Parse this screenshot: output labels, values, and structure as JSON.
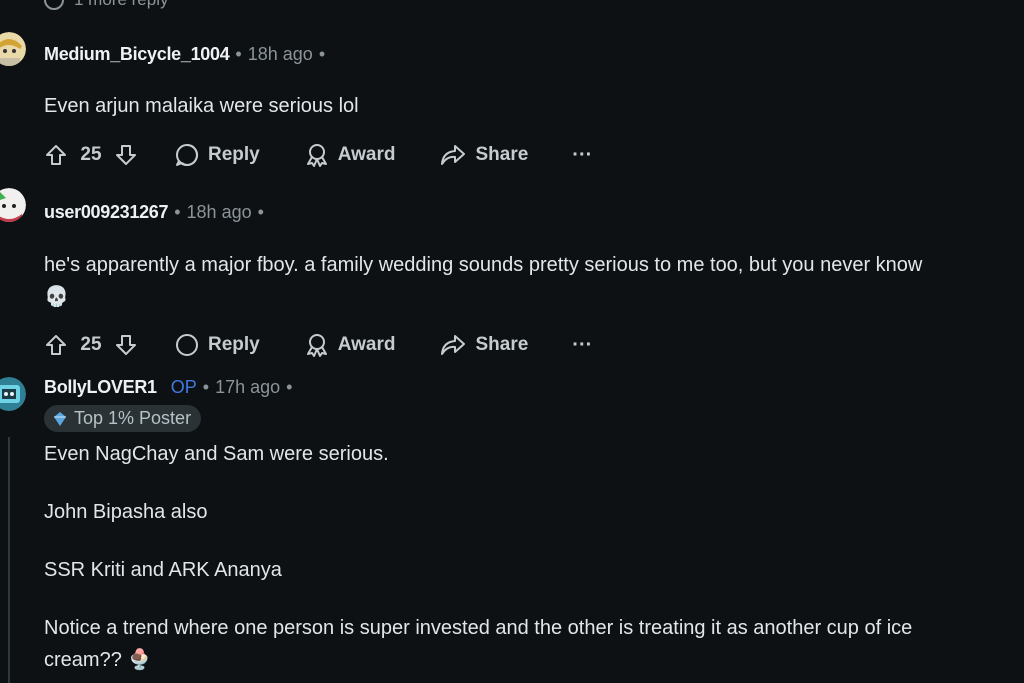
{
  "more_reply": {
    "label": "1 more reply"
  },
  "comments": [
    {
      "username": "Medium_Bicycle_1004",
      "op": "",
      "time": "18h ago",
      "flair": "",
      "body": [
        "Even arjun malaika were serious lol"
      ],
      "votes": "25",
      "actions": {
        "reply": "Reply",
        "award": "Award",
        "share": "Share",
        "more": "···"
      }
    },
    {
      "username": "user009231267",
      "op": "",
      "time": "18h ago",
      "flair": "",
      "body": [
        "he's apparently a major fboy. a family wedding sounds pretty serious to me too, but you never know",
        "💀"
      ],
      "votes": "25",
      "actions": {
        "reply": "Reply",
        "award": "Award",
        "share": "Share",
        "more": "···"
      }
    },
    {
      "username": "BollyLOVER1",
      "op": "OP",
      "time": "17h ago",
      "flair": "Top 1% Poster",
      "body": [
        "Even NagChay and Sam were serious.",
        "John Bipasha also",
        "SSR Kriti and ARK Ananya",
        "Notice a trend where one person is super invested and the other is treating it as another cup of ice",
        "cream?? 🍨"
      ]
    }
  ],
  "separator": "•",
  "colors": {
    "background": "#0e1113",
    "text": "#d7dadc",
    "muted": "#8a9499",
    "op": "#3d7be0",
    "flair_bg": "#2a3236"
  }
}
